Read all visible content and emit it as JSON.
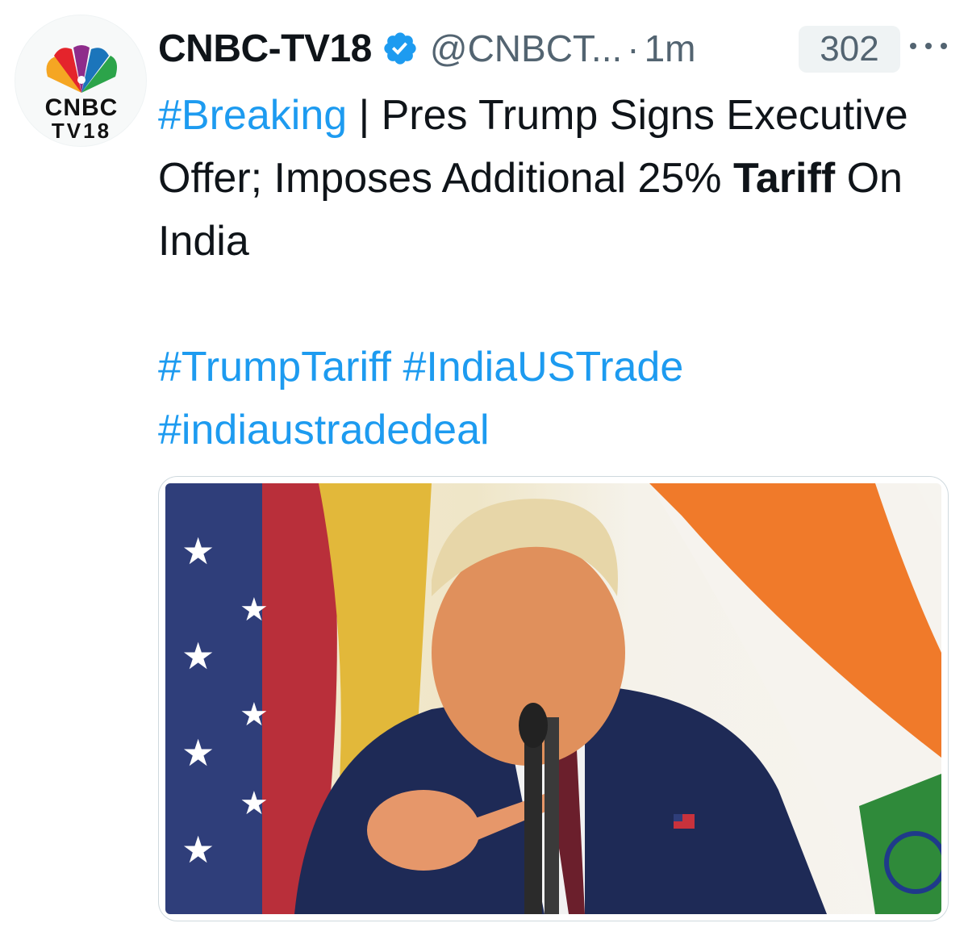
{
  "account": {
    "avatar_text_line1": "CNBC",
    "avatar_text_line2": "TV18",
    "name": "CNBC-TV18",
    "handle": "@CNBCT...",
    "separator": "·",
    "time": "1m",
    "count": "302"
  },
  "tweet": {
    "hashtag_breaking": "#Breaking",
    "separator": "|",
    "headline_part1": "Pres Trump Signs Executive Offer; Imposes Additional 25%",
    "headline_bold": "Tariff",
    "headline_part2": "On India",
    "hashtag_trump_tariff": "#TrumpTariff",
    "hashtag_india_us_trade": "#IndiaUSTrade",
    "hashtag_india_us_trade_deal": "#indiaustradedeal"
  },
  "icons": {
    "verified": "verified-badge-icon",
    "more": "more-options-icon",
    "logo": "cnbc-peacock-logo"
  },
  "colors": {
    "link": "#1d9bf0",
    "secondary_text": "#536471",
    "badge_bg": "#eff3f4",
    "verified": "#1d9bf0"
  }
}
